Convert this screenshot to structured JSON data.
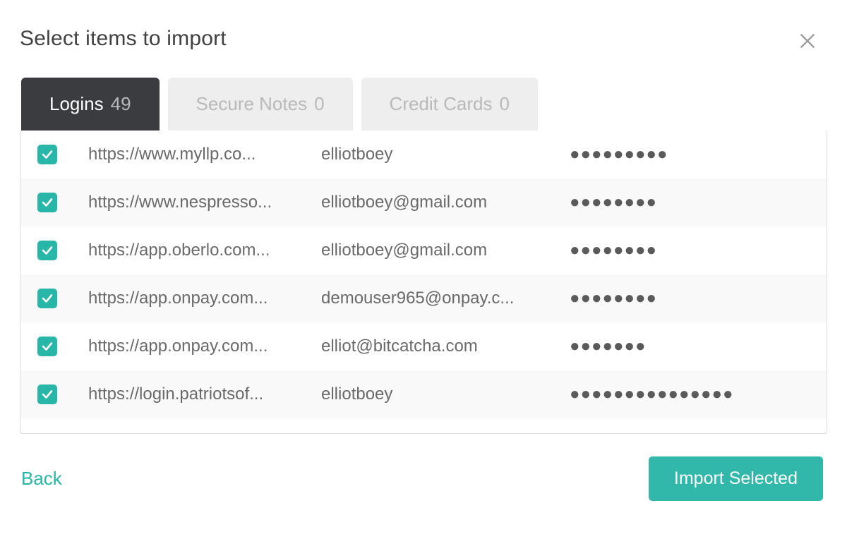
{
  "dialog": {
    "title": "Select items to import"
  },
  "tabs": [
    {
      "label": "Logins",
      "count": "49",
      "active": true
    },
    {
      "label": "Secure Notes",
      "count": "0",
      "active": false
    },
    {
      "label": "Credit Cards",
      "count": "0",
      "active": false
    }
  ],
  "rows": [
    {
      "checked": true,
      "url": "https://www.myllp.co...",
      "user": "elliotboey",
      "password_mask": "●●●●●●●●●"
    },
    {
      "checked": true,
      "url": "https://www.nespresso...",
      "user": "elliotboey@gmail.com",
      "password_mask": "●●●●●●●●"
    },
    {
      "checked": true,
      "url": "https://app.oberlo.com...",
      "user": "elliotboey@gmail.com",
      "password_mask": "●●●●●●●●"
    },
    {
      "checked": true,
      "url": "https://app.onpay.com...",
      "user": "demouser965@onpay.c...",
      "password_mask": "●●●●●●●●"
    },
    {
      "checked": true,
      "url": "https://app.onpay.com...",
      "user": "elliot@bitcatcha.com",
      "password_mask": "●●●●●●●"
    },
    {
      "checked": true,
      "url": "https://login.patriotsof...",
      "user": "elliotboey",
      "password_mask": "●●●●●●●●●●●●●●●"
    }
  ],
  "footer": {
    "back_label": "Back",
    "import_label": "Import Selected"
  }
}
